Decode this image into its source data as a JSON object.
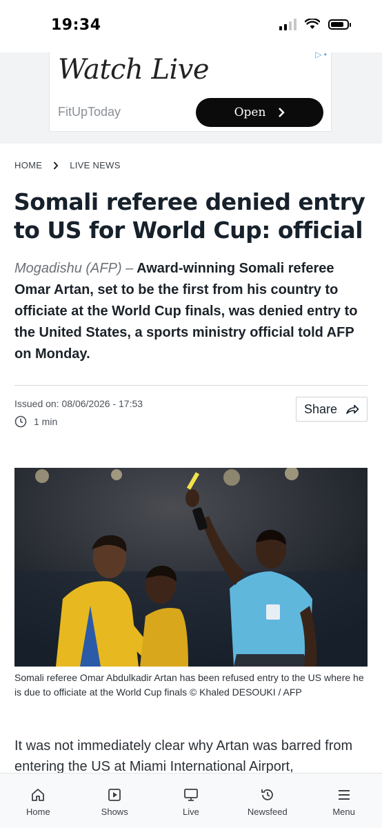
{
  "status_bar": {
    "time": "19:34"
  },
  "ad": {
    "title": "Watch Live",
    "source": "FitUpToday",
    "button_label": "Open"
  },
  "breadcrumb": {
    "home": "HOME",
    "section": "LIVE NEWS"
  },
  "article": {
    "title": "Somali referee denied entry to US for World Cup: official",
    "dateline": "Mogadishu (AFP) –",
    "lead": "Award-winning Somali referee Omar Artan, set to be the first from his country to officiate at the World Cup finals, was denied entry to the United States, a sports ministry official told AFP on Monday.",
    "issued": "Issued on: 08/06/2026 - 17:53",
    "read_time": "1 min",
    "share_label": "Share",
    "caption": "Somali referee Omar Abdulkadir Artan has been refused entry to the US where he is due to officiate at the World Cup finals © Khaled DESOUKI / AFP",
    "body": "It was not immediately clear why Artan was barred from entering the US at Miami International Airport,"
  },
  "bottom_nav": {
    "items": [
      {
        "label": "Home",
        "icon": "home-icon"
      },
      {
        "label": "Shows",
        "icon": "play-icon"
      },
      {
        "label": "Live",
        "icon": "tv-icon"
      },
      {
        "label": "Newsfeed",
        "icon": "history-icon"
      },
      {
        "label": "Menu",
        "icon": "hamburger-icon"
      }
    ]
  },
  "colors": {
    "headline": "#17212b",
    "ad_background": "#f1f3f4",
    "ad_button": "#0b0b0b",
    "ref_shirt": "#5fb7dc"
  }
}
